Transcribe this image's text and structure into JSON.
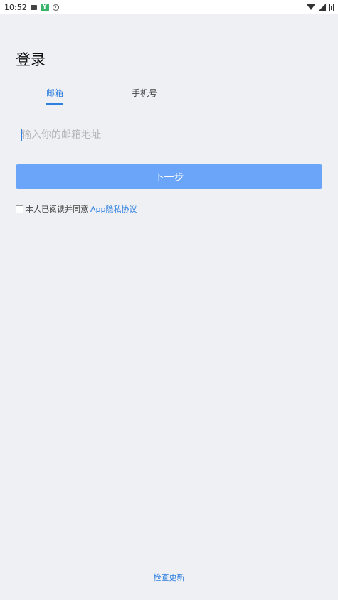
{
  "status_bar": {
    "time": "10:52",
    "icons": [
      "cat-icon",
      "app-icon",
      "eye-icon",
      "wifi-icon",
      "signal-icon",
      "battery-icon"
    ],
    "app_icon_glyph": "Y"
  },
  "page": {
    "title": "登录"
  },
  "tabs": {
    "email_label": "邮箱",
    "phone_label": "手机号",
    "active": "email"
  },
  "email_input": {
    "value": "",
    "placeholder": "输入你的邮箱地址"
  },
  "next_button": {
    "label": "下一步"
  },
  "agreement": {
    "checked": false,
    "text": "本人已阅读并同意",
    "link_text": "App隐私协议"
  },
  "footer": {
    "check_update_label": "检查更新"
  },
  "colors": {
    "accent": "#2f7fe0",
    "button": "#6aa5fa",
    "background": "#eff0f3"
  }
}
